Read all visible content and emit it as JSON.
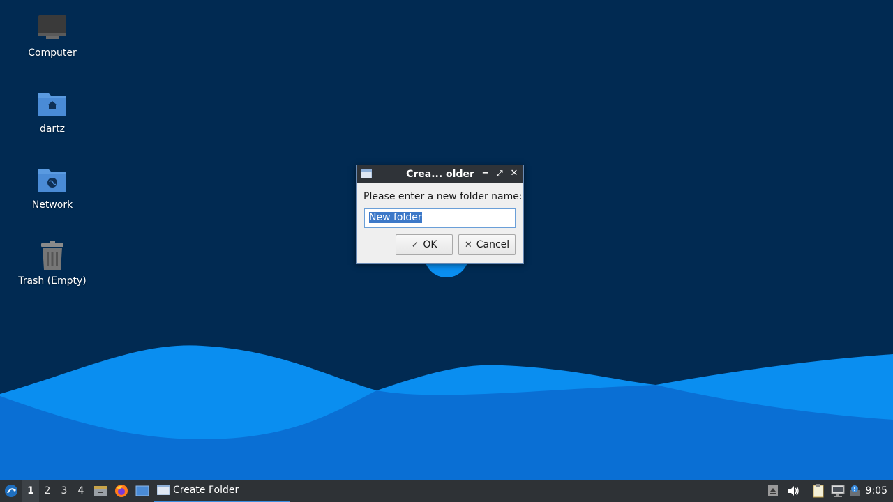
{
  "desktop": {
    "icons": [
      {
        "label": "Computer"
      },
      {
        "label": "dartz"
      },
      {
        "label": "Network"
      },
      {
        "label": "Trash (Empty)"
      }
    ]
  },
  "dialog": {
    "title": "Crea... older",
    "prompt": "Please enter a new folder name:",
    "input_value": "New folder",
    "ok_label": "OK",
    "cancel_label": "Cancel",
    "minimize_glyph": "−",
    "restore_glyph": "⤢",
    "close_glyph": "✕"
  },
  "taskbar": {
    "workspaces": [
      "1",
      "2",
      "3",
      "4"
    ],
    "active_workspace": "1",
    "task_label": "Create Folder",
    "clock": "9:05"
  },
  "colors": {
    "desktop_bg": "#012a52",
    "wave_light": "#0a8ef0",
    "wave_dark": "#0a6fd4",
    "taskbar_bg": "#2e3236",
    "accent": "#3c8ee0"
  }
}
